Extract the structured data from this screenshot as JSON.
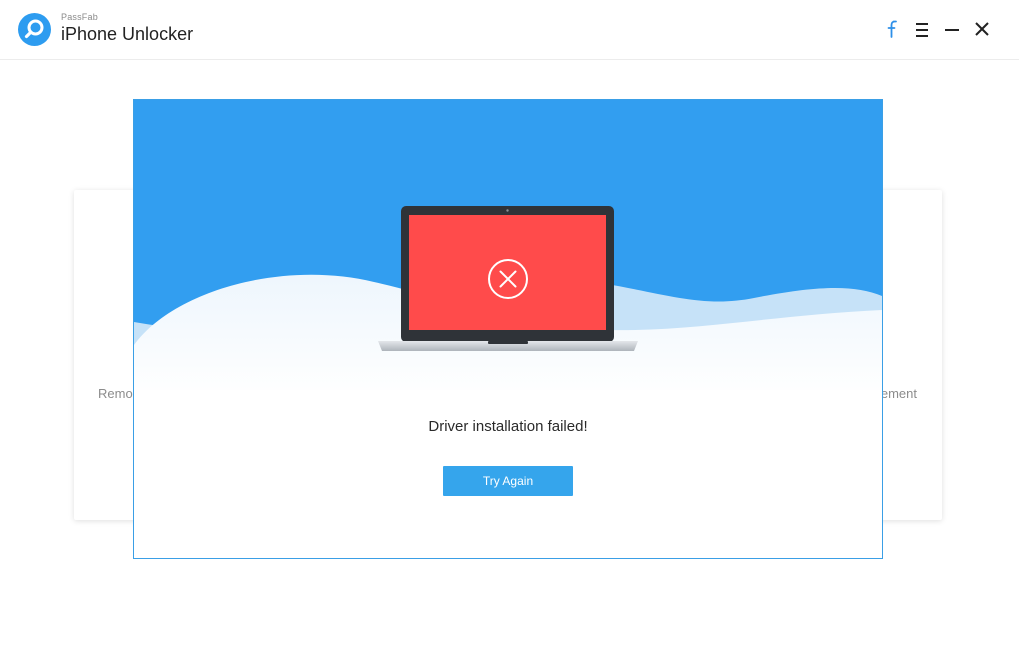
{
  "app": {
    "brand_small": "PassFab",
    "title": "iPhone Unlocker"
  },
  "titlebar": {
    "icons": [
      "facebook-icon",
      "menu-icon",
      "minimize-icon",
      "close-icon"
    ]
  },
  "background_cards": {
    "left_text": "Remo",
    "right_text": "ement"
  },
  "dialog": {
    "message": "Driver installation failed!",
    "button_label": "Try Again",
    "illustration": "laptop-error-icon"
  },
  "colors": {
    "accent": "#35a5ec",
    "hero_blue": "#329ef0",
    "error_red": "#ff4b4b",
    "laptop_frame": "#2f3338"
  }
}
